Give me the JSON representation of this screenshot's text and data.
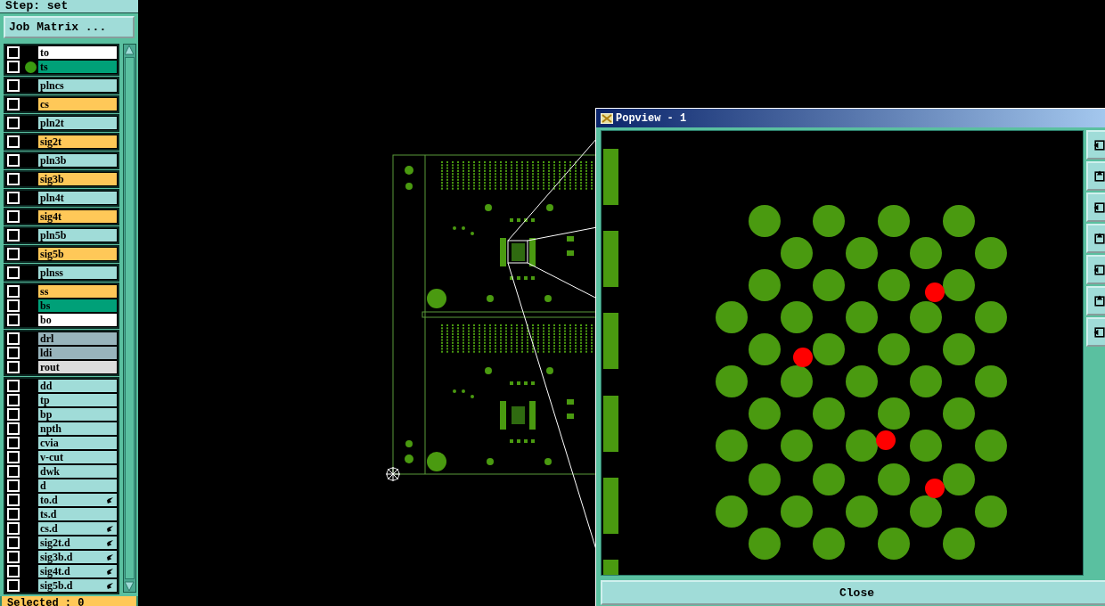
{
  "step_label": "Step: set",
  "job_matrix_button": "Job Matrix ...",
  "layer_groups": [
    {
      "layers": [
        {
          "name": "to",
          "color": "#ffffff",
          "checked": false,
          "work_layer": false,
          "linked": false
        },
        {
          "name": "ts",
          "color": "#00a078",
          "checked": false,
          "work_layer": true,
          "linked": false
        }
      ]
    },
    {
      "layers": [
        {
          "name": "plncs",
          "color": "#a0dcd8",
          "checked": false,
          "work_layer": false,
          "linked": false
        }
      ]
    },
    {
      "layers": [
        {
          "name": "cs",
          "color": "#ffc858",
          "checked": false,
          "work_layer": false,
          "linked": false
        }
      ]
    },
    {
      "layers": [
        {
          "name": "pln2t",
          "color": "#a0dcd8",
          "checked": false,
          "work_layer": false,
          "linked": false
        }
      ]
    },
    {
      "layers": [
        {
          "name": "sig2t",
          "color": "#ffc858",
          "checked": false,
          "work_layer": false,
          "linked": false
        }
      ]
    },
    {
      "layers": [
        {
          "name": "pln3b",
          "color": "#a0dcd8",
          "checked": false,
          "work_layer": false,
          "linked": false
        }
      ]
    },
    {
      "layers": [
        {
          "name": "sig3b",
          "color": "#ffc858",
          "checked": false,
          "work_layer": false,
          "linked": false
        }
      ]
    },
    {
      "layers": [
        {
          "name": "pln4t",
          "color": "#a0dcd8",
          "checked": false,
          "work_layer": false,
          "linked": false
        }
      ]
    },
    {
      "layers": [
        {
          "name": "sig4t",
          "color": "#ffc858",
          "checked": false,
          "work_layer": false,
          "linked": false
        }
      ]
    },
    {
      "layers": [
        {
          "name": "pln5b",
          "color": "#a0dcd8",
          "checked": false,
          "work_layer": false,
          "linked": false
        }
      ]
    },
    {
      "layers": [
        {
          "name": "sig5b",
          "color": "#ffc858",
          "checked": false,
          "work_layer": false,
          "linked": false
        }
      ]
    },
    {
      "layers": [
        {
          "name": "plnss",
          "color": "#a0dcd8",
          "checked": false,
          "work_layer": false,
          "linked": false
        }
      ]
    },
    {
      "layers": [
        {
          "name": "ss",
          "color": "#ffc858",
          "checked": false,
          "work_layer": false,
          "linked": false
        },
        {
          "name": "bs",
          "color": "#00a078",
          "checked": false,
          "work_layer": false,
          "linked": false
        },
        {
          "name": "bo",
          "color": "#ffffff",
          "checked": false,
          "work_layer": false,
          "linked": false
        }
      ]
    },
    {
      "layers": [
        {
          "name": "drl",
          "color": "#98b4bc",
          "checked": false,
          "work_layer": false,
          "linked": false
        },
        {
          "name": "ldi",
          "color": "#98b4bc",
          "checked": false,
          "work_layer": false,
          "linked": false
        },
        {
          "name": "rout",
          "color": "#dcdcdc",
          "checked": false,
          "work_layer": false,
          "linked": false
        }
      ]
    },
    {
      "layers": [
        {
          "name": "dd",
          "color": "#a0dcd8",
          "checked": false,
          "work_layer": false,
          "linked": false
        },
        {
          "name": "tp",
          "color": "#a0dcd8",
          "checked": false,
          "work_layer": false,
          "linked": false
        },
        {
          "name": "bp",
          "color": "#a0dcd8",
          "checked": false,
          "work_layer": false,
          "linked": false
        },
        {
          "name": "npth",
          "color": "#a0dcd8",
          "checked": false,
          "work_layer": false,
          "linked": false
        },
        {
          "name": "cvia",
          "color": "#a0dcd8",
          "checked": false,
          "work_layer": false,
          "linked": false
        },
        {
          "name": "v-cut",
          "color": "#a0dcd8",
          "checked": false,
          "work_layer": false,
          "linked": false
        },
        {
          "name": "dwk",
          "color": "#a0dcd8",
          "checked": false,
          "work_layer": false,
          "linked": false
        },
        {
          "name": "d",
          "color": "#a0dcd8",
          "checked": false,
          "work_layer": false,
          "linked": false
        },
        {
          "name": "to.d",
          "color": "#a0dcd8",
          "checked": false,
          "work_layer": false,
          "linked": true
        },
        {
          "name": "ts.d",
          "color": "#a0dcd8",
          "checked": false,
          "work_layer": false,
          "linked": false
        },
        {
          "name": "cs.d",
          "color": "#a0dcd8",
          "checked": false,
          "work_layer": false,
          "linked": true
        },
        {
          "name": "sig2t.d",
          "color": "#a0dcd8",
          "checked": false,
          "work_layer": false,
          "linked": true
        },
        {
          "name": "sig3b.d",
          "color": "#a0dcd8",
          "checked": false,
          "work_layer": false,
          "linked": true
        },
        {
          "name": "sig4t.d",
          "color": "#a0dcd8",
          "checked": false,
          "work_layer": false,
          "linked": true
        },
        {
          "name": "sig5b.d",
          "color": "#a0dcd8",
          "checked": false,
          "work_layer": false,
          "linked": true
        }
      ]
    }
  ],
  "selected_status": "Selected : 0",
  "popview": {
    "title": "Popview - 1",
    "close_button": "Close"
  }
}
